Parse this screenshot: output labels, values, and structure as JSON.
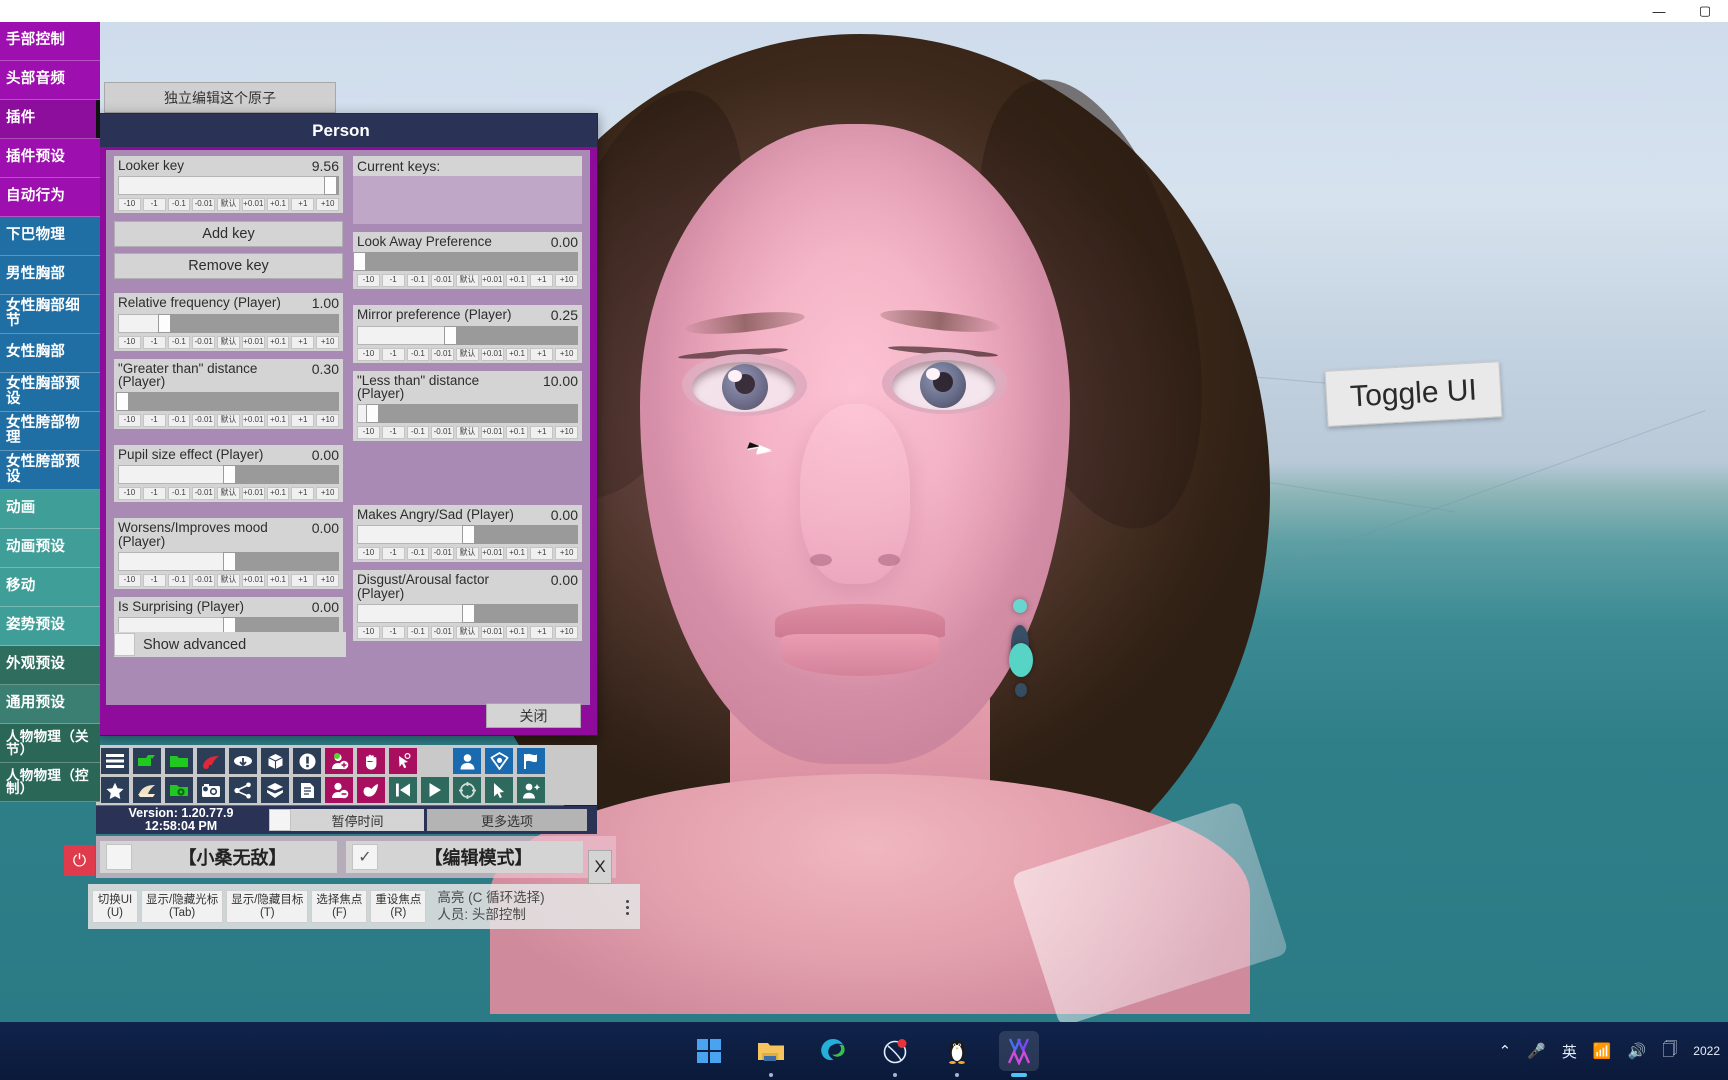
{
  "titlebar": {
    "minimize": "—",
    "maximize": "▢"
  },
  "sidebar": {
    "items": [
      {
        "label": "手部控制",
        "tone": "purple",
        "selected": false
      },
      {
        "label": "头部音频",
        "tone": "purple",
        "selected": false
      },
      {
        "label": "插件",
        "tone": "purple",
        "selected": true
      },
      {
        "label": "插件预设",
        "tone": "purple",
        "selected": false
      },
      {
        "label": "自动行为",
        "tone": "purple",
        "selected": false
      },
      {
        "label": "下巴物理",
        "tone": "blue",
        "selected": false
      },
      {
        "label": "男性胸部",
        "tone": "blue",
        "selected": false
      },
      {
        "label": "女性胸部细节",
        "tone": "blue",
        "selected": false
      },
      {
        "label": "女性胸部",
        "tone": "blue",
        "selected": false
      },
      {
        "label": "女性胸部预设",
        "tone": "blue",
        "selected": false
      },
      {
        "label": "女性胯部物理",
        "tone": "blue",
        "selected": false
      },
      {
        "label": "女性胯部预设",
        "tone": "blue",
        "selected": false
      },
      {
        "label": "动画",
        "tone": "teal",
        "selected": false
      },
      {
        "label": "动画预设",
        "tone": "teal",
        "selected": false
      },
      {
        "label": "移动",
        "tone": "teal",
        "selected": false
      },
      {
        "label": "姿势预设",
        "tone": "teal",
        "selected": false
      },
      {
        "label": "外观预设",
        "tone": "green2",
        "selected": false
      },
      {
        "label": "通用预设",
        "tone": "green",
        "selected": false
      },
      {
        "label": "人物物理（关节）",
        "tone": "green3",
        "selected": false
      },
      {
        "label": "人物物理（控制）",
        "tone": "green3",
        "selected": false
      }
    ]
  },
  "viewport": {
    "toggle_ui_label": "Toggle UI",
    "edit_atom_label": "独立编辑这个原子"
  },
  "panel": {
    "title": "Person",
    "close_label": "关闭",
    "step_buttons": [
      "-10",
      "-1",
      "-0.1",
      "-0.01",
      "默认",
      "+0.01",
      "+0.1",
      "+1",
      "+10"
    ],
    "add_key_label": "Add key",
    "remove_key_label": "Remove key",
    "current_keys_label": "Current keys:",
    "show_advanced_label": "Show advanced",
    "left_sliders": [
      {
        "name": "Looker key",
        "value": "9.56",
        "fill_pct": 96,
        "knob_pct": 96
      },
      {
        "name": "Relative frequency (Player)",
        "value": "1.00",
        "fill_pct": 21,
        "knob_pct": 21
      },
      {
        "name": "\"Greater than\" distance (Player)",
        "value": "0.30",
        "fill_pct": 2,
        "knob_pct": 2
      },
      {
        "name": "Pupil size effect (Player)",
        "value": "0.00",
        "fill_pct": 50,
        "knob_pct": 50
      },
      {
        "name": "Worsens/Improves mood (Player)",
        "value": "0.00",
        "fill_pct": 50,
        "knob_pct": 50
      },
      {
        "name": "Is Surprising (Player)",
        "value": "0.00",
        "fill_pct": 50,
        "knob_pct": 50
      }
    ],
    "right_sliders": [
      {
        "name": "Look Away Preference",
        "value": "0.00",
        "fill_pct": 1,
        "knob_pct": 1
      },
      {
        "name": "Mirror preference (Player)",
        "value": "0.25",
        "fill_pct": 42,
        "knob_pct": 42
      },
      {
        "name": "\"Less than\" distance (Player)",
        "value": "10.00",
        "fill_pct": 7,
        "knob_pct": 7
      },
      {
        "name": "Makes Angry/Sad (Player)",
        "value": "0.00",
        "fill_pct": 50,
        "knob_pct": 50
      },
      {
        "name": "Disgust/Arousal factor (Player)",
        "value": "0.00",
        "fill_pct": 50,
        "knob_pct": 50
      }
    ]
  },
  "toolbar": {
    "row1": [
      {
        "icon": "hamburger-menu-icon",
        "tone": "navy"
      },
      {
        "icon": "open-scene-icon",
        "tone": "navy"
      },
      {
        "icon": "folder-icon",
        "tone": "navy"
      },
      {
        "icon": "save-scene-icon",
        "tone": "navy"
      },
      {
        "icon": "cloud-download-icon",
        "tone": "navy"
      },
      {
        "icon": "package-box-icon",
        "tone": "navy"
      },
      {
        "icon": "alert-exclamation-icon",
        "tone": "navy"
      },
      {
        "icon": "add-person-icon",
        "tone": "mag"
      },
      {
        "icon": "hand-grab-icon",
        "tone": "mag"
      },
      {
        "icon": "click-pointer-icon",
        "tone": "mag"
      },
      {
        "icon": "spacer",
        "tone": "gap"
      },
      {
        "icon": "person-icon",
        "tone": "blue"
      },
      {
        "icon": "unity-logo-icon",
        "tone": "blue"
      },
      {
        "icon": "flag-icon",
        "tone": "blue"
      }
    ],
    "row2": [
      {
        "icon": "star-icon",
        "tone": "navy"
      },
      {
        "icon": "load-look-icon",
        "tone": "navy"
      },
      {
        "icon": "folder-settings-icon",
        "tone": "navy"
      },
      {
        "icon": "camera-icon",
        "tone": "navy"
      },
      {
        "icon": "node-graph-icon",
        "tone": "navy"
      },
      {
        "icon": "open-package-icon",
        "tone": "navy"
      },
      {
        "icon": "document-icon",
        "tone": "navy"
      },
      {
        "icon": "remove-person-icon",
        "tone": "mag"
      },
      {
        "icon": "pinch-hand-icon",
        "tone": "mag"
      },
      {
        "icon": "skip-previous-icon",
        "tone": "grn"
      },
      {
        "icon": "play-icon",
        "tone": "grn"
      },
      {
        "icon": "target-reticle-icon",
        "tone": "grn"
      },
      {
        "icon": "select-cursor-icon",
        "tone": "grn"
      },
      {
        "icon": "people-group-icon",
        "tone": "grn"
      }
    ]
  },
  "statusbar": {
    "version": "Version: 1.20.77.9",
    "time": "12:58:04 PM",
    "pause_label": "暂停时间",
    "more_options_label": "更多选项"
  },
  "modebar": {
    "mode1_label": "【小桑无敌】",
    "mode1_checked": false,
    "mode2_label": "【编辑模式】",
    "mode2_checked": true,
    "check_glyph": "✓",
    "close_x_label": "X",
    "power_glyph": "⏻"
  },
  "hintbar": {
    "buttons": [
      {
        "line1": "切换UI",
        "line2": "(U)"
      },
      {
        "line1": "显示/隐藏光标",
        "line2": "(Tab)"
      },
      {
        "line1": "显示/隐藏目标",
        "line2": "(T)"
      },
      {
        "line1": "选择焦点",
        "line2": "(F)"
      },
      {
        "line1": "重设焦点",
        "line2": "(R)"
      }
    ],
    "info_line1": "高亮 (C 循环选择)",
    "info_line2": "人员: 头部控制"
  },
  "taskbar": {
    "apps": [
      {
        "icon": "windows-start-icon",
        "running": false
      },
      {
        "icon": "file-explorer-icon",
        "running": true
      },
      {
        "icon": "edge-browser-icon",
        "running": false
      },
      {
        "icon": "media-app-icon",
        "running": true
      },
      {
        "icon": "penguin-app-icon",
        "running": true
      },
      {
        "icon": "vam-app-icon",
        "running": true,
        "active": true
      }
    ],
    "tray": [
      {
        "icon": "chevron-up-icon",
        "glyph": "⌃"
      },
      {
        "icon": "microphone-icon",
        "glyph": "🎤"
      },
      {
        "icon": "ime-language-icon",
        "glyph": "英"
      },
      {
        "icon": "wifi-icon",
        "glyph": "📶"
      },
      {
        "icon": "volume-icon",
        "glyph": "🔊"
      },
      {
        "icon": "battery-icon",
        "glyph": "🗍"
      }
    ],
    "clock": "2022"
  }
}
